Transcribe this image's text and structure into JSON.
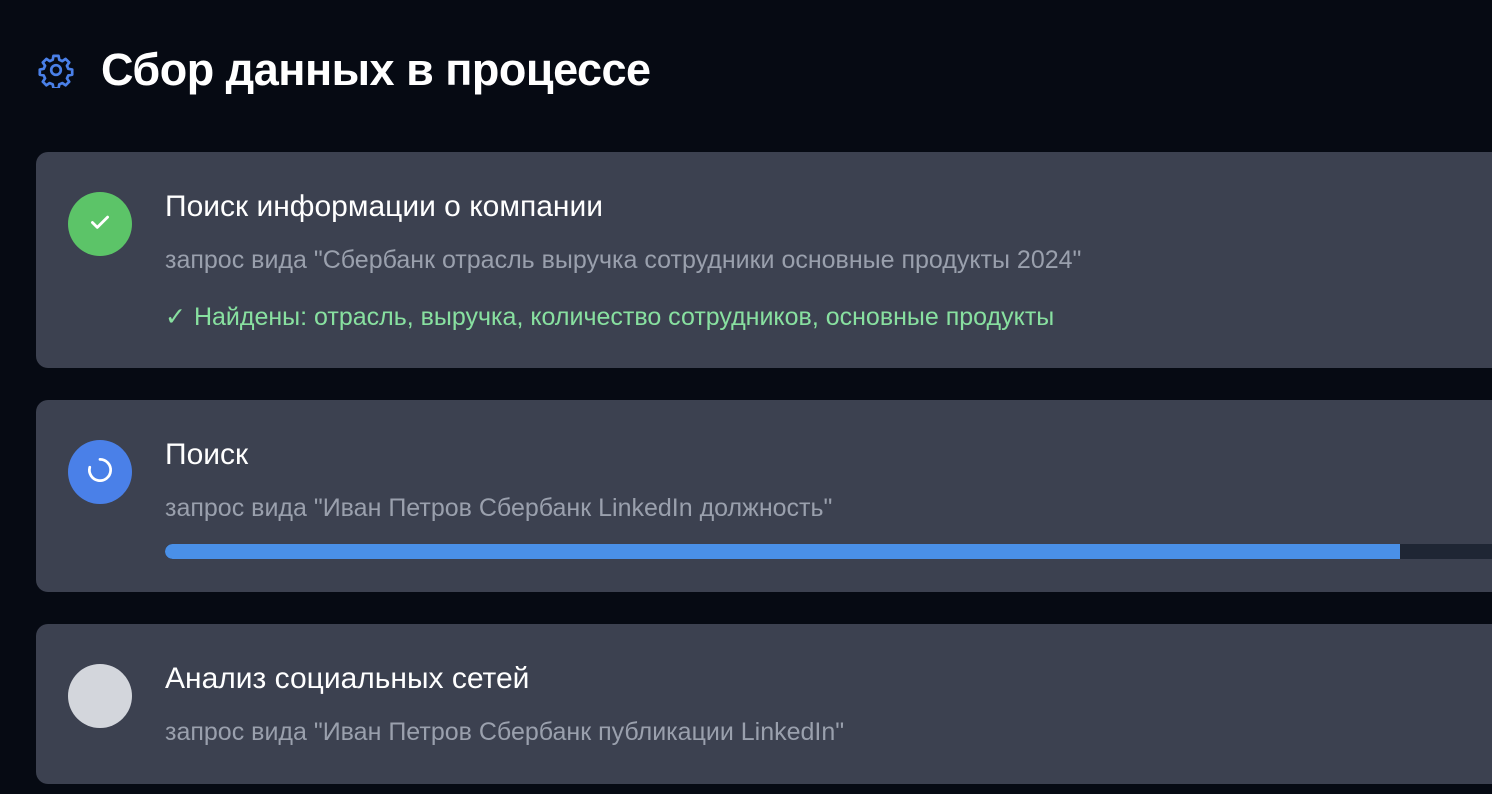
{
  "header": {
    "icon": "gear-icon",
    "title": "Сбор данных в процессе",
    "accent_color": "#4a80e8"
  },
  "steps": [
    {
      "status": "done",
      "status_icon": "check-icon",
      "title": "Поиск информации о компании",
      "query": "запрос вида \"Сбербанк отрасль выручка сотрудники основные продукты 2024\"",
      "result_mark": "✓",
      "result": "Найдены: отрасль, выручка, количество сотрудников, основные продукты"
    },
    {
      "status": "in-progress",
      "status_icon": "spinner-icon",
      "title": "Поиск",
      "query": "запрос вида \"Иван Петров Сбербанк LinkedIn должность\"",
      "progress": 0.914
    },
    {
      "status": "pending",
      "status_icon": "pending-circle-icon",
      "title": "Анализ социальных сетей",
      "query": "запрос вида \"Иван Петров Сбербанк публикации LinkedIn\""
    }
  ],
  "colors": {
    "background": "#060a13",
    "card": "#3c4150",
    "done": "#5cc468",
    "active": "#4a80e8",
    "pending": "#d3d6dc",
    "progress_fill": "#4a90e8",
    "progress_track": "#1f2634",
    "result_text": "#88e0a0"
  }
}
